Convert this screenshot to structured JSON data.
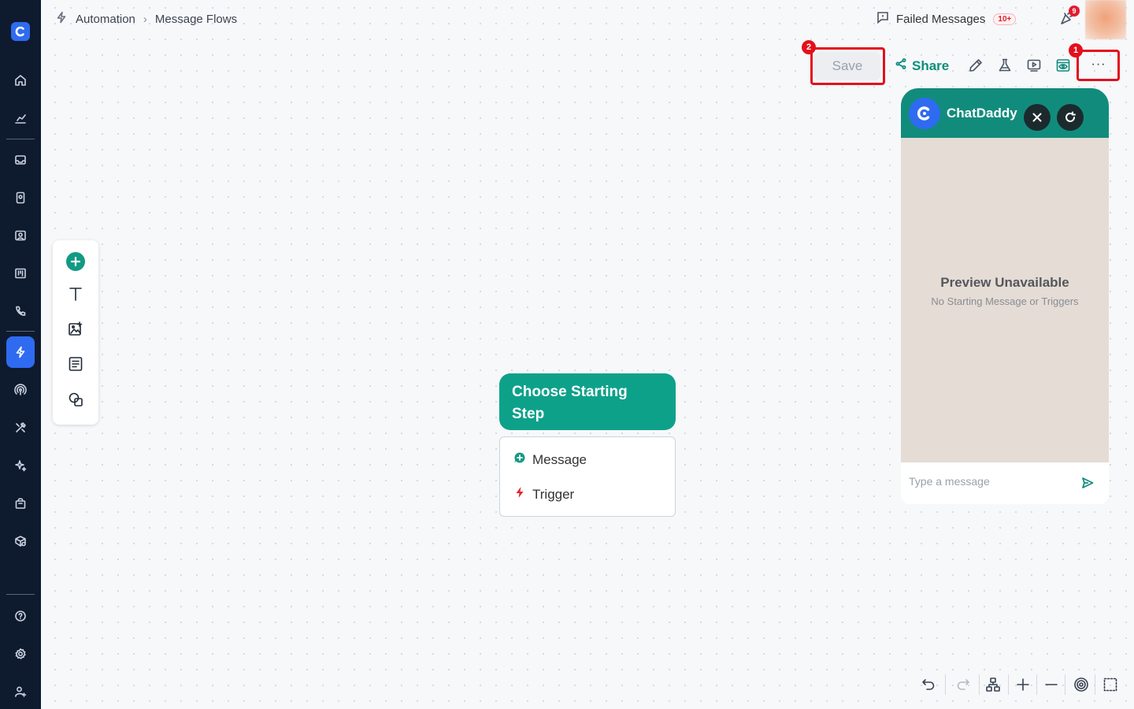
{
  "breadcrumb": {
    "section": "Automation",
    "page": "Message Flows"
  },
  "header": {
    "failed_messages_label": "Failed Messages",
    "failed_messages_badge": "10+",
    "notification_count": "9"
  },
  "toolbar": {
    "save_label": "Save",
    "share_label": "Share",
    "more_label": "···"
  },
  "annotations": {
    "save_marker": "2",
    "more_marker": "1"
  },
  "chat_preview": {
    "brand_name": "ChatDaddy",
    "preview_title": "Preview Unavailable",
    "preview_subtitle": "No Starting Message or Triggers",
    "input_placeholder": "Type a message"
  },
  "start_node": {
    "title": "Choose Starting Step",
    "options": [
      "Message",
      "Trigger"
    ]
  },
  "sidebar": {
    "items": [
      "home",
      "analytics",
      "inbox",
      "contacts",
      "team-inbox",
      "board",
      "calls",
      "automation",
      "broadcast",
      "tools",
      "ai",
      "shop",
      "settings-box",
      "help",
      "settings",
      "users"
    ]
  },
  "colors": {
    "accent": "#0ea18a",
    "brand": "#2f6bf0",
    "sidebar_bg": "#0e1a2e",
    "highlight": "#e3101d"
  }
}
